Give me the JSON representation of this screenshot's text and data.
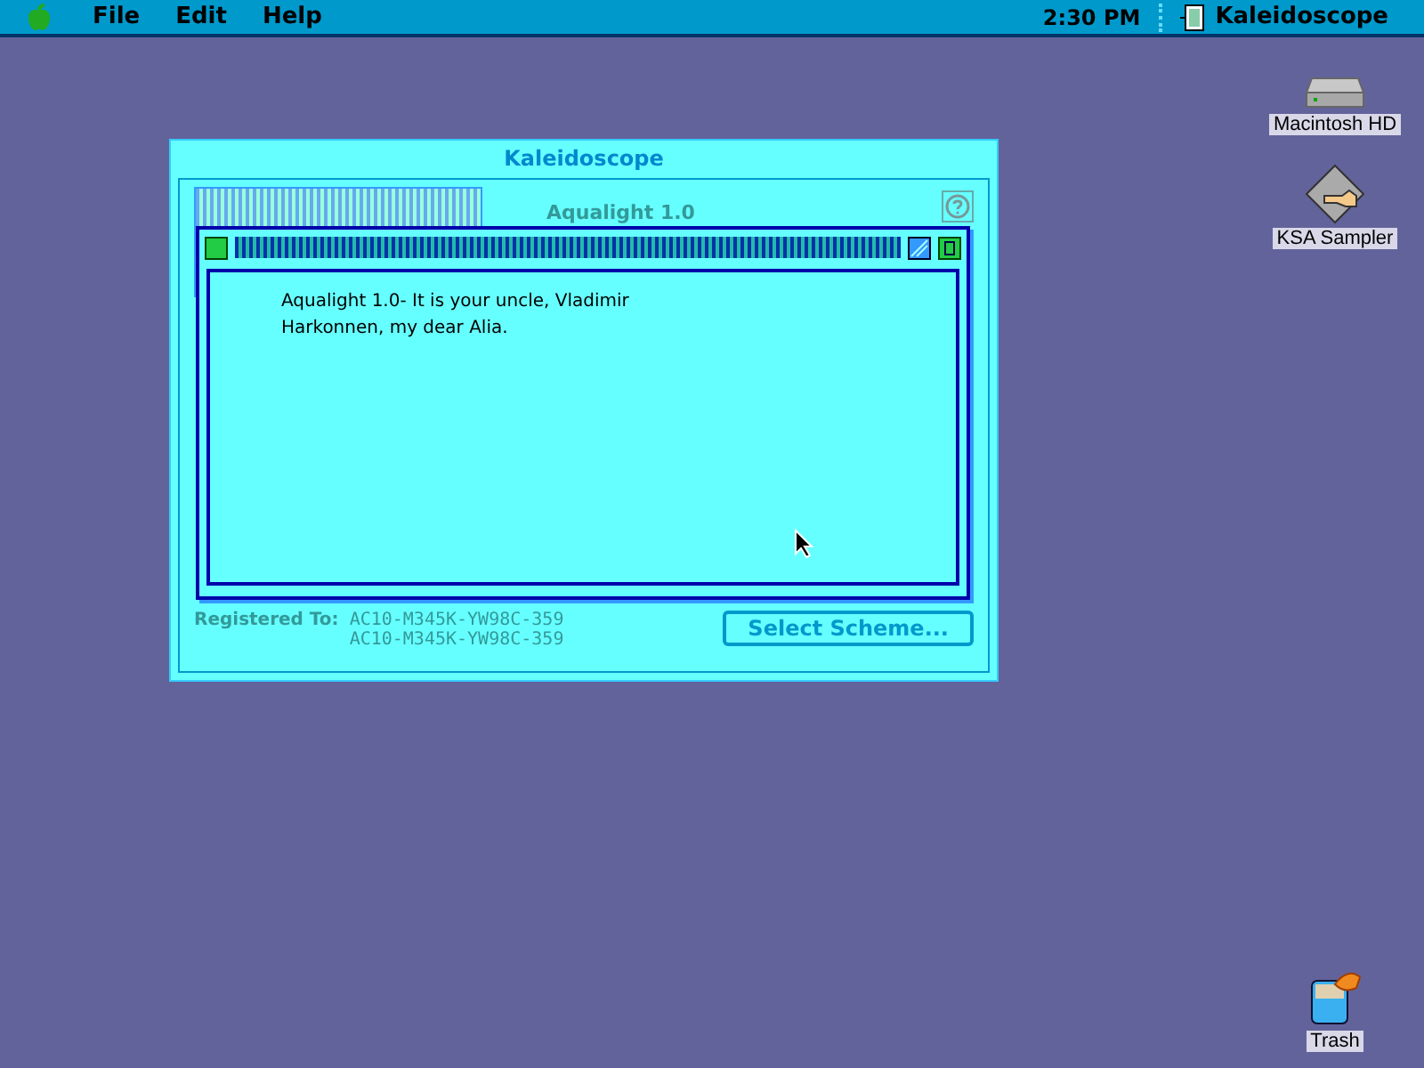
{
  "menu_bar": {
    "menus": [
      "File",
      "Edit",
      "Help"
    ],
    "clock": "2:30 PM",
    "active_app": "Kaleidoscope"
  },
  "desktop_icons": [
    {
      "label": "Macintosh HD",
      "kind": "disk"
    },
    {
      "label": "KSA Sampler",
      "kind": "sampler"
    },
    {
      "label": "Trash",
      "kind": "trash"
    }
  ],
  "control_panel": {
    "title": "Kaleidoscope",
    "scheme_name": "Aqualight 1.0",
    "registered_label": "Registered To:",
    "registration_lines": [
      "AC10-M345K-YW98C-359",
      "AC10-M345K-YW98C-359"
    ],
    "button": "Select Scheme..."
  },
  "about_window": {
    "message": "Aqualight 1.0- It is your uncle, Vladimir Harkonnen, my dear Alia."
  }
}
